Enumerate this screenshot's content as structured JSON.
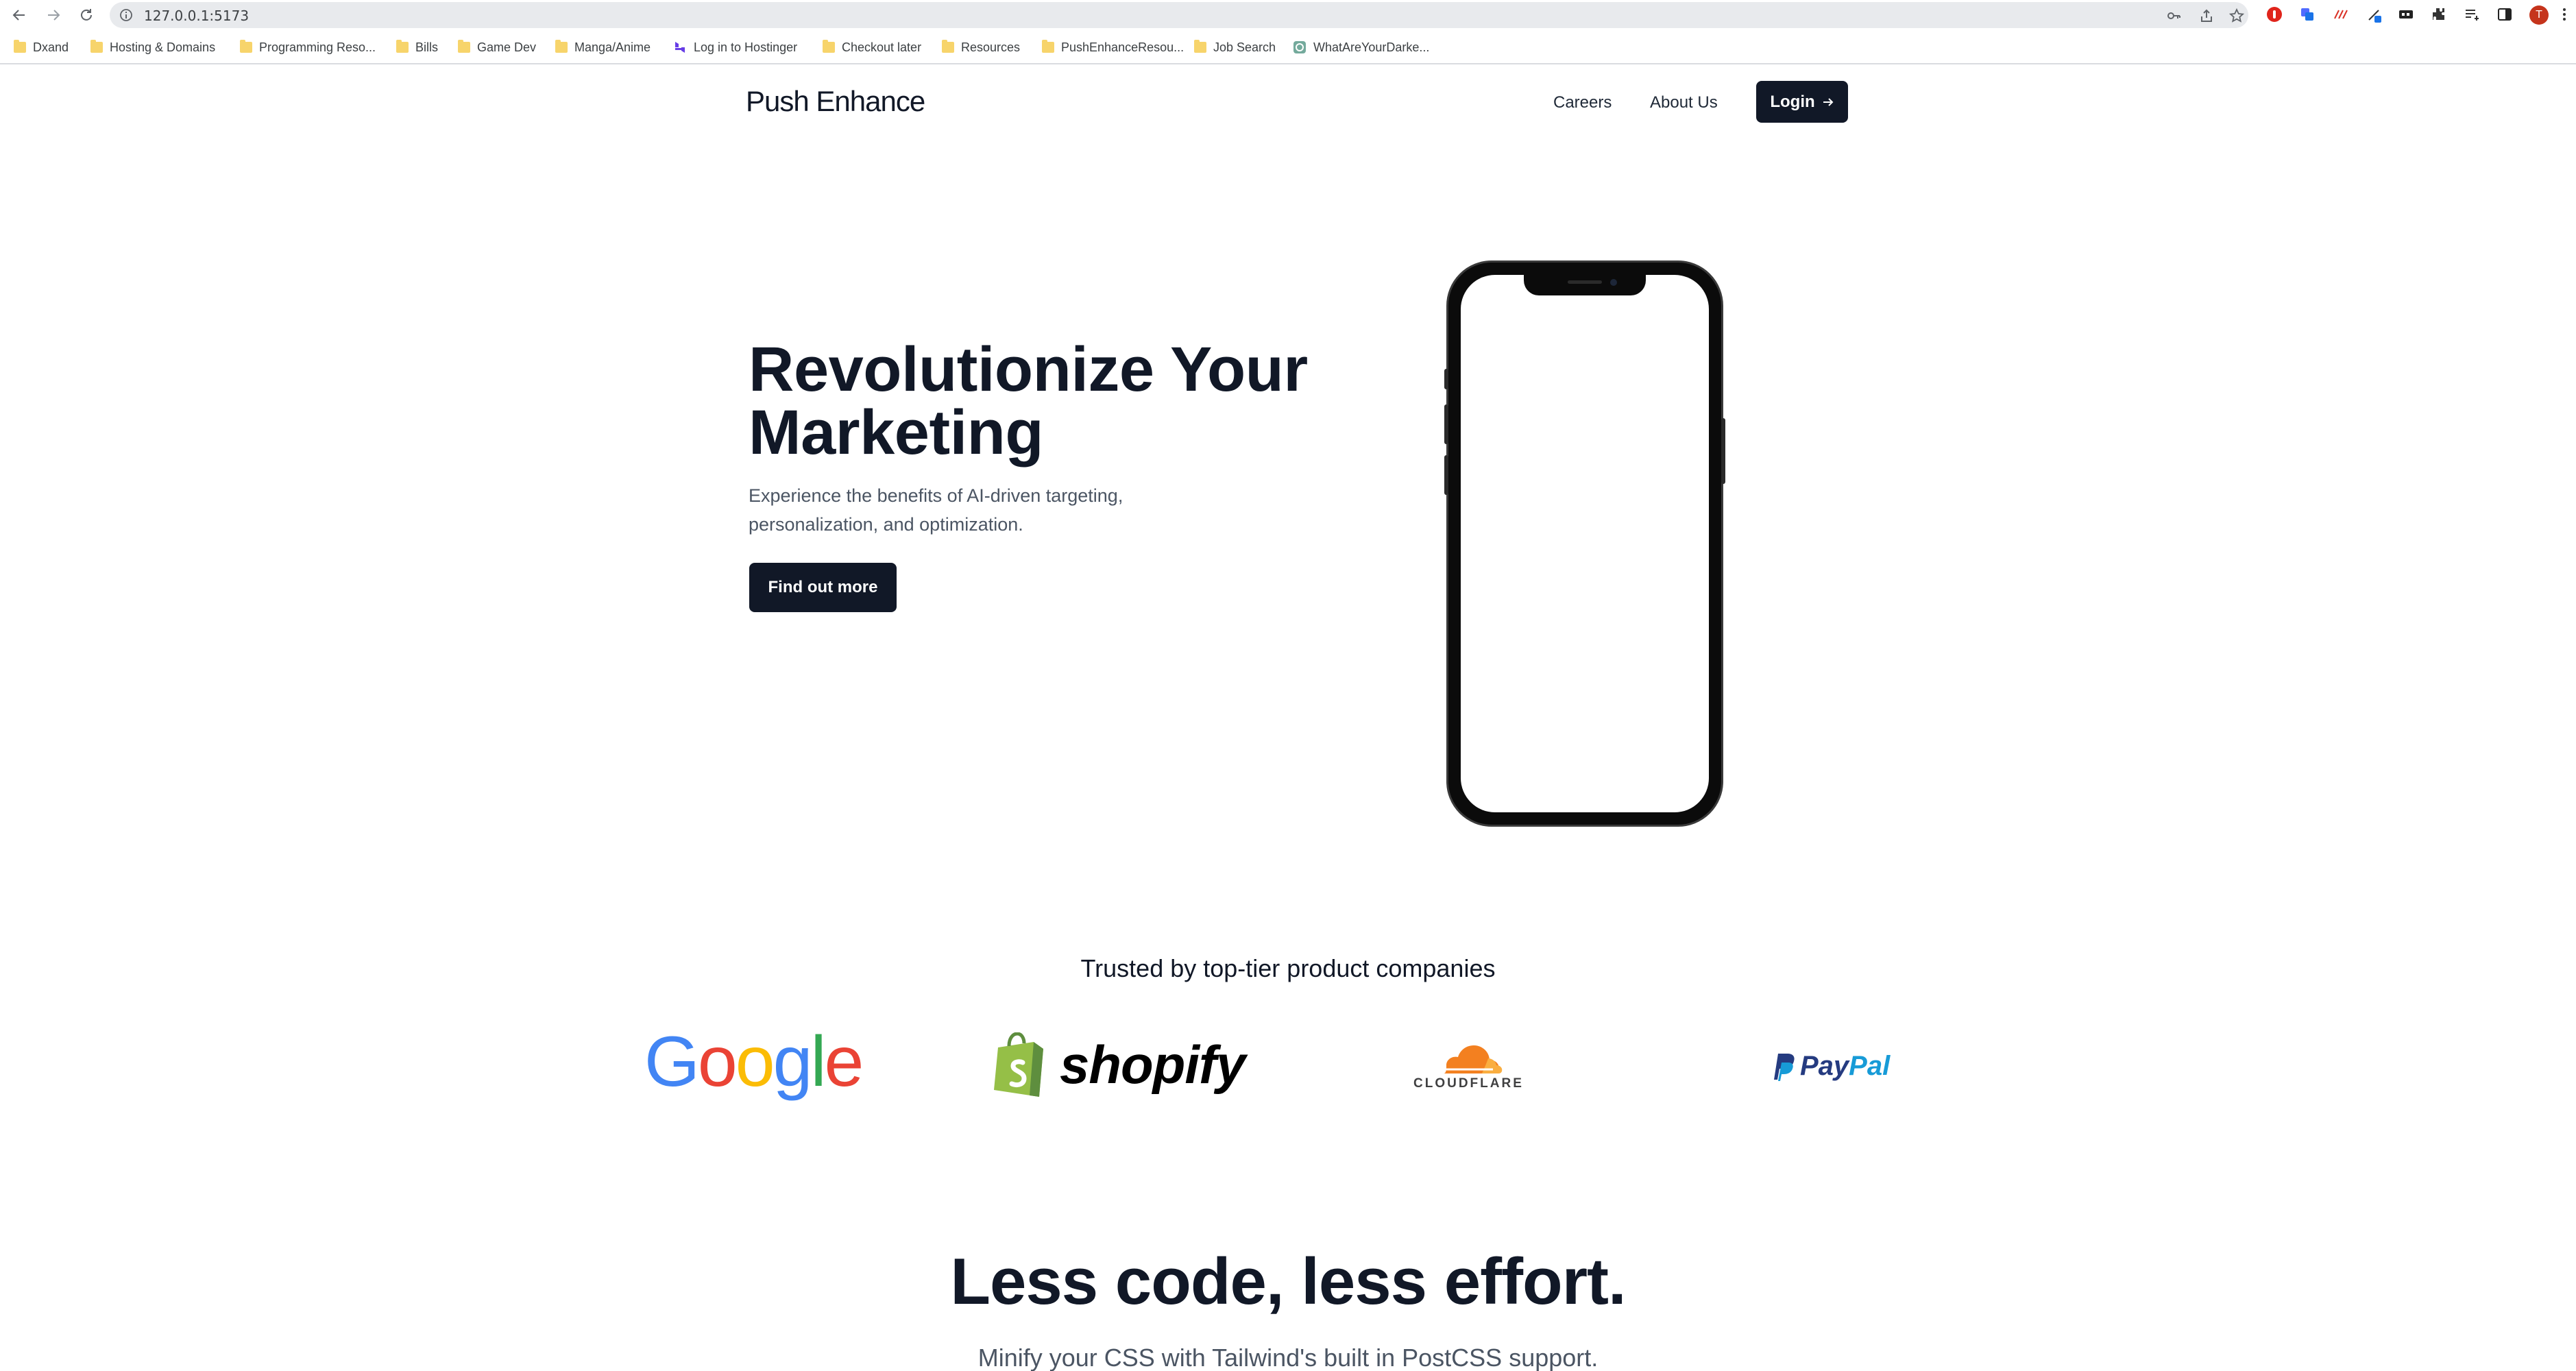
{
  "browser": {
    "url": "127.0.0.1:5173",
    "bookmarks": [
      {
        "label": "Dxand"
      },
      {
        "label": "Hosting & Domains"
      },
      {
        "label": "Programming Reso..."
      },
      {
        "label": "Bills"
      },
      {
        "label": "Game Dev"
      },
      {
        "label": "Manga/Anime"
      },
      {
        "label": "Log in to Hostinger"
      },
      {
        "label": "Checkout later"
      },
      {
        "label": "Resources"
      },
      {
        "label": "PushEnhanceResou..."
      },
      {
        "label": "Job Search"
      },
      {
        "label": "WhatAreYourDarke..."
      }
    ],
    "profile_initial": "T"
  },
  "header": {
    "brand": "Push Enhance",
    "nav": [
      "Careers",
      "About Us"
    ],
    "login_label": "Login"
  },
  "hero": {
    "title_line1": "Revolutionize Your",
    "title_line2": "Marketing",
    "subtitle_line1": "Experience the benefits of AI-driven targeting,",
    "subtitle_line2": "personalization, and optimization.",
    "cta_label": "Find out more"
  },
  "trusted": {
    "heading": "Trusted by top-tier product companies",
    "logos": [
      {
        "name": "Google",
        "letters": [
          "G",
          "o",
          "o",
          "g",
          "l",
          "e"
        ]
      },
      {
        "name": "shopify"
      },
      {
        "name": "CLOUDFLARE"
      },
      {
        "name_part1": "Pay",
        "name_part2": "Pal"
      }
    ]
  },
  "section2": {
    "title": "Less code, less effort.",
    "subtitle": "Minify your CSS with Tailwind's built in PostCSS support."
  },
  "colors": {
    "dark": "#111827",
    "google_blue": "#4285F4",
    "google_red": "#EA4335",
    "google_yellow": "#FBBC05",
    "google_green": "#34A853",
    "shopify_green": "#95BF47",
    "cloudflare_orange": "#F38020",
    "paypal_dark": "#253B80",
    "paypal_light": "#179BD7"
  }
}
